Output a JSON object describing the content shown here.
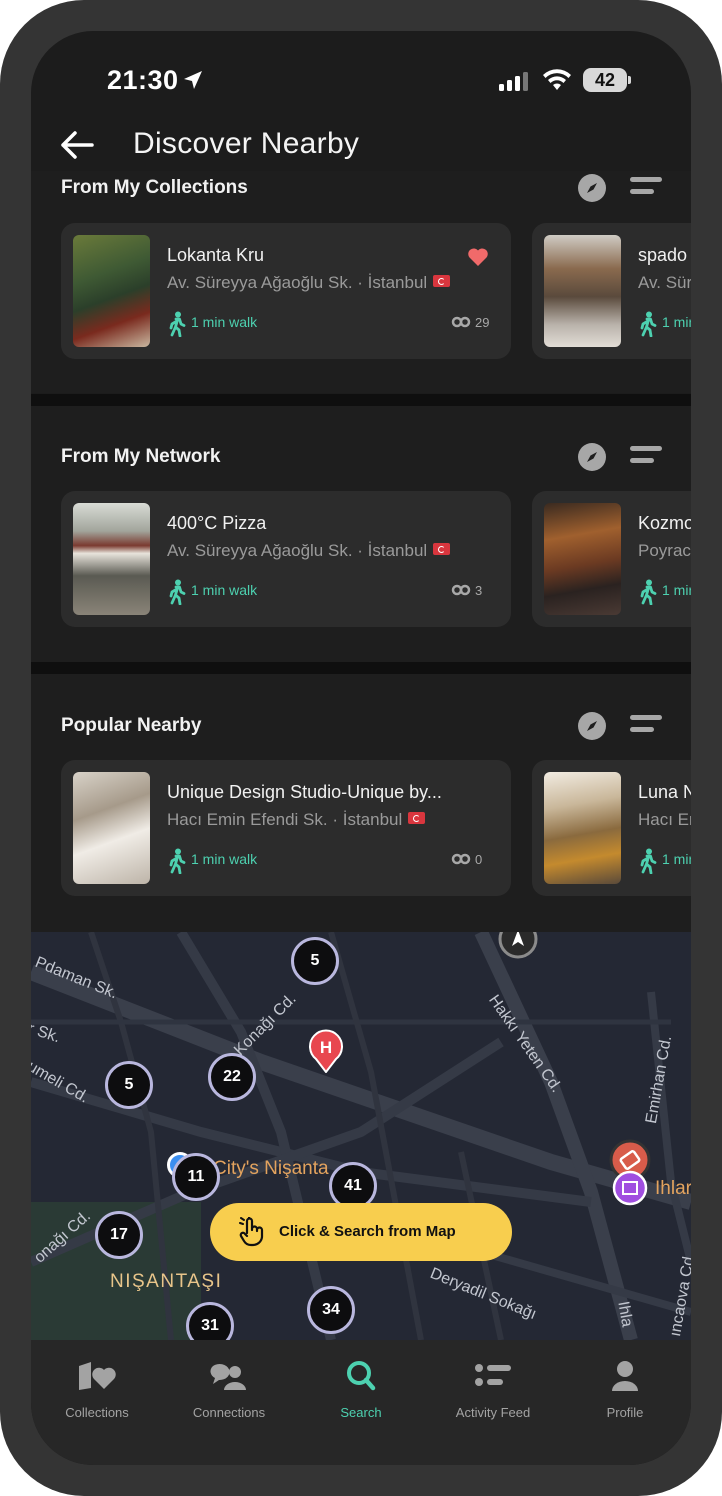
{
  "status": {
    "time": "21:30",
    "battery": "42"
  },
  "header": {
    "title": "Discover Nearby"
  },
  "sections": [
    {
      "title": "From My Collections",
      "cards": [
        {
          "name": "Lokanta Kru",
          "address": "Av. Süreyya Ağaoğlu Sk. · İstanbul",
          "walk": "1 min walk",
          "links": "29",
          "favorite": true
        },
        {
          "name": "spado",
          "address": "Av. Sür",
          "walk": "1 min"
        }
      ]
    },
    {
      "title": "From My Network",
      "cards": [
        {
          "name": "400°C Pizza",
          "address": "Av. Süreyya Ağaoğlu Sk. · İstanbul",
          "walk": "1 min walk",
          "links": "3"
        },
        {
          "name": "Kozmo",
          "address": "Poyrac",
          "walk": "1 min"
        }
      ]
    },
    {
      "title": "Popular Nearby",
      "cards": [
        {
          "name": "Unique Design Studio-Unique by...",
          "address": "Hacı Emin Efendi Sk. · İstanbul",
          "walk": "1 min walk",
          "links": "0"
        },
        {
          "name": "Luna N",
          "address": "Hacı Er",
          "walk": "1 min"
        }
      ]
    }
  ],
  "map": {
    "streets": [
      "Pdaman Sk.",
      "r Sk.",
      "umeli Cd.",
      "Konağı Cd.",
      "Hakkı Yeten Cd.",
      "Emirhan Cd.",
      "onağı Cd.",
      "Deryadil Sokağı",
      "ıncaova Cd",
      "Ihla"
    ],
    "clusters": [
      "5",
      "22",
      "5",
      "11",
      "41",
      "17",
      "34",
      "31"
    ],
    "poi_label": "City's Nişanta",
    "poi_label_2": "Ihlar",
    "district": "NIŞANTAŞI",
    "hospital_marker": "H",
    "cta": "Click & Search from Map"
  },
  "tabs": [
    {
      "label": "Collections",
      "icon": "collections-icon"
    },
    {
      "label": "Connections",
      "icon": "connections-icon"
    },
    {
      "label": "Search",
      "icon": "search-icon",
      "active": true
    },
    {
      "label": "Activity Feed",
      "icon": "activity-feed-icon"
    },
    {
      "label": "Profile",
      "icon": "profile-icon"
    }
  ],
  "colors": {
    "accent": "#4dd1b0",
    "cta": "#f8ce4e",
    "favorite": "#f06a6a",
    "background": "#1c1c1c",
    "card": "#2c2c2c"
  }
}
